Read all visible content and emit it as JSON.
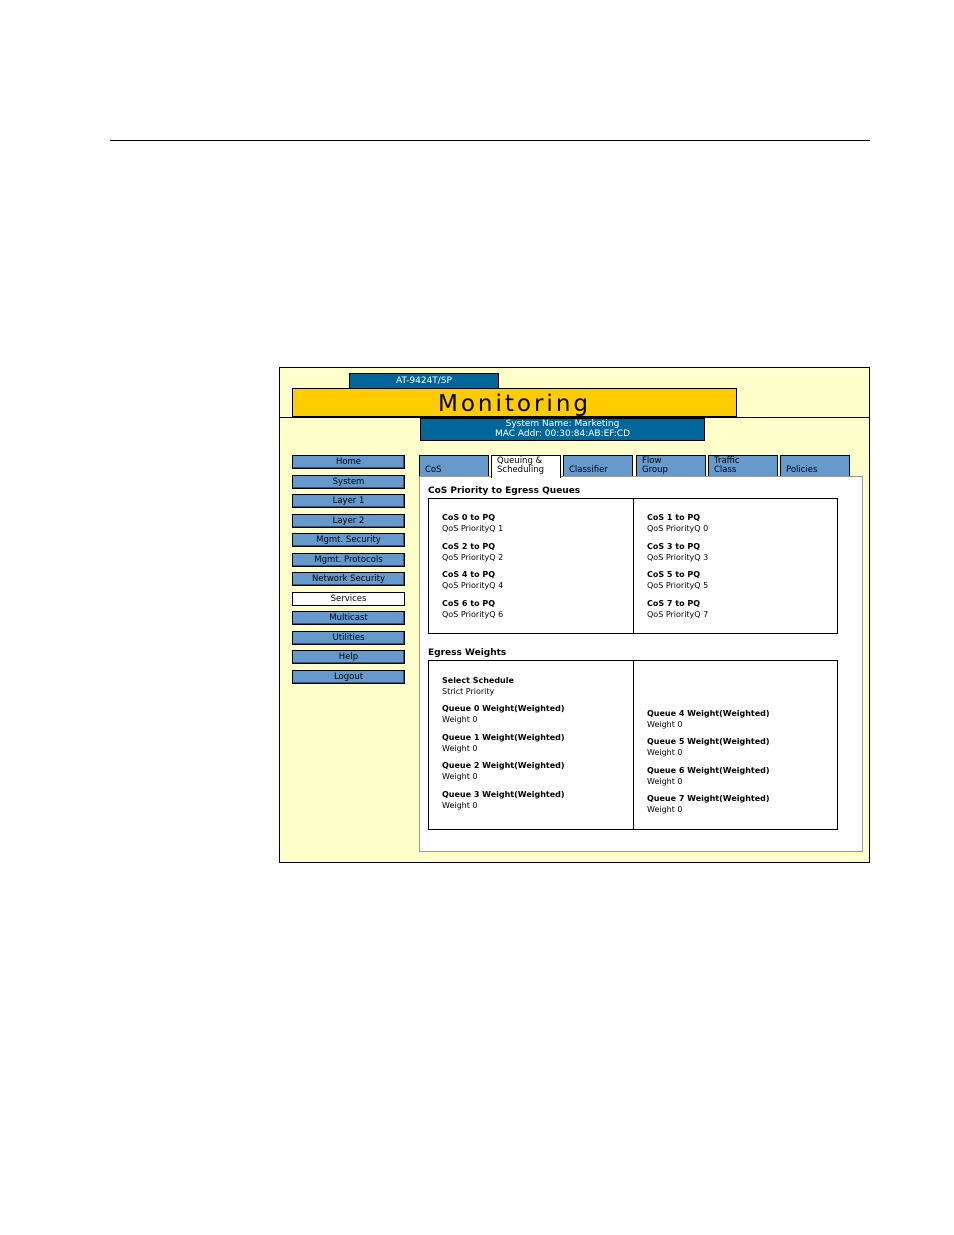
{
  "device": {
    "model": "AT-9424T/SP"
  },
  "banner": {
    "title": "Monitoring"
  },
  "system": {
    "name_line": "System Name: Marketing",
    "mac_line": "MAC Addr: 00:30:84:AB:EF:CD"
  },
  "nav": {
    "items": [
      {
        "label": "Home"
      },
      {
        "label": "System"
      },
      {
        "label": "Layer 1"
      },
      {
        "label": "Layer 2"
      },
      {
        "label": "Mgmt. Security"
      },
      {
        "label": "Mgmt. Protocols"
      },
      {
        "label": "Network Security"
      },
      {
        "label": "Services"
      },
      {
        "label": "Multicast"
      },
      {
        "label": "Utilities"
      },
      {
        "label": "Help"
      },
      {
        "label": "Logout"
      }
    ],
    "active": "Services"
  },
  "tabs": [
    {
      "line1": "",
      "line2": "CoS"
    },
    {
      "line1": "Queuing &",
      "line2": "Scheduling"
    },
    {
      "line1": "",
      "line2": "Classifier"
    },
    {
      "line1": "Flow",
      "line2": "Group"
    },
    {
      "line1": "Traffic",
      "line2": "Class"
    },
    {
      "line1": "",
      "line2": "Policies"
    }
  ],
  "cos_section": {
    "title": "CoS Priority to Egress Queues",
    "items": [
      {
        "label": "CoS 0 to PQ",
        "value": "QoS PriorityQ 1"
      },
      {
        "label": "CoS 1 to PQ",
        "value": "QoS PriorityQ 0"
      },
      {
        "label": "CoS 2 to PQ",
        "value": "QoS PriorityQ 2"
      },
      {
        "label": "CoS 3 to PQ",
        "value": "QoS PriorityQ 3"
      },
      {
        "label": "CoS 4 to PQ",
        "value": "QoS PriorityQ 4"
      },
      {
        "label": "CoS 5 to PQ",
        "value": "QoS PriorityQ 5"
      },
      {
        "label": "CoS 6 to PQ",
        "value": "QoS PriorityQ 6"
      },
      {
        "label": "CoS 7 to PQ",
        "value": "QoS PriorityQ 7"
      }
    ]
  },
  "egress_section": {
    "title": "Egress Weights",
    "schedule": {
      "label": "Select Schedule",
      "value": "Strict Priority"
    },
    "left": [
      {
        "label": "Queue 0 Weight(Weighted)",
        "value": "Weight 0"
      },
      {
        "label": "Queue 1 Weight(Weighted)",
        "value": "Weight 0"
      },
      {
        "label": "Queue 2 Weight(Weighted)",
        "value": "Weight 0"
      },
      {
        "label": "Queue 3 Weight(Weighted)",
        "value": "Weight 0"
      }
    ],
    "right": [
      {
        "label": "Queue 4 Weight(Weighted)",
        "value": "Weight 0"
      },
      {
        "label": "Queue 5 Weight(Weighted)",
        "value": "Weight 0"
      },
      {
        "label": "Queue 6 Weight(Weighted)",
        "value": "Weight 0"
      },
      {
        "label": "Queue 7 Weight(Weighted)",
        "value": "Weight 0"
      }
    ]
  },
  "colors": {
    "frame_bg": "#ffffcc",
    "banner": "#ffcc00",
    "header_blue": "#006699",
    "button_blue": "#6699cc"
  }
}
